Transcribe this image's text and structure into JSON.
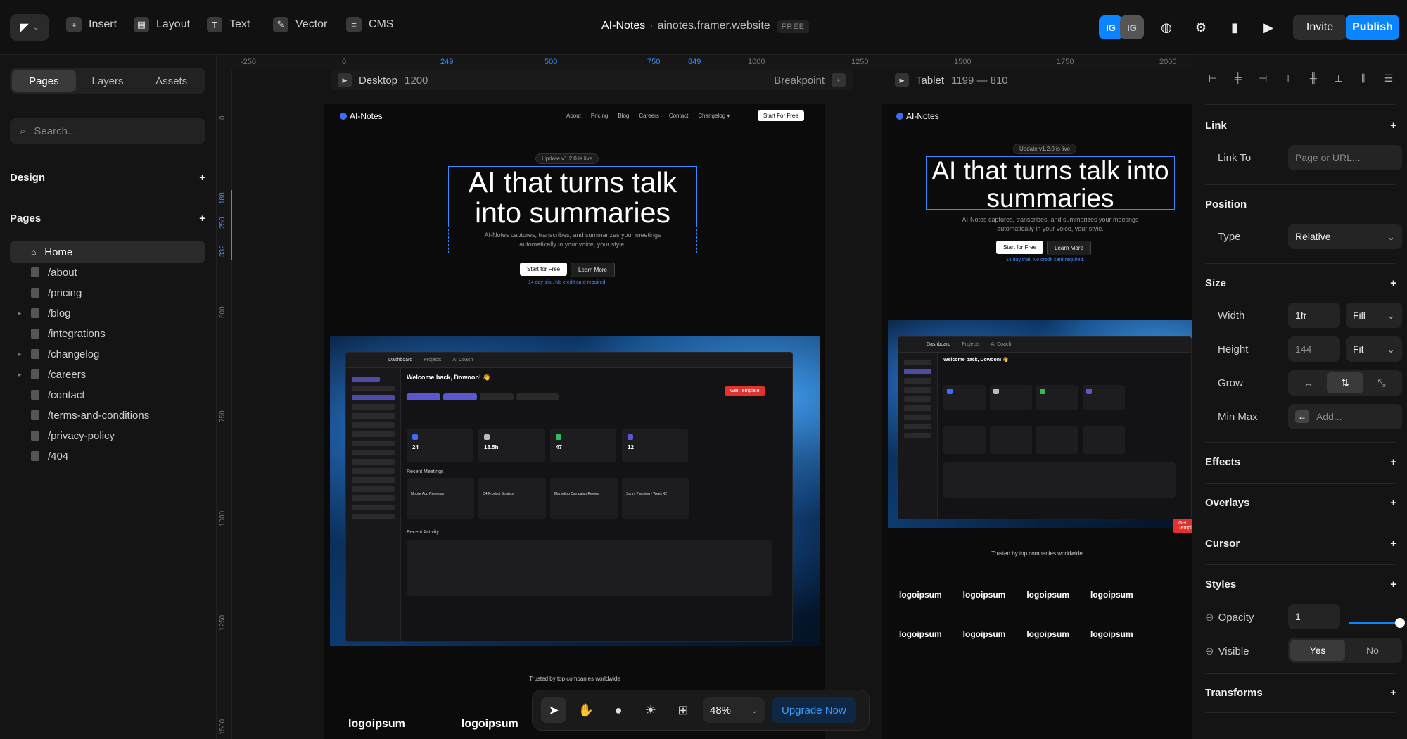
{
  "toolbar": {
    "tools": [
      {
        "label": "Insert",
        "icon": "plus-square-icon"
      },
      {
        "label": "Layout",
        "icon": "grid-icon"
      },
      {
        "label": "Text",
        "icon": "text-t-icon"
      },
      {
        "label": "Vector",
        "icon": "pen-icon"
      },
      {
        "label": "CMS",
        "icon": "database-icon"
      }
    ],
    "title": "AI-Notes",
    "title_sep": "·",
    "url": "ainotes.framer.website",
    "plan_badge": "FREE",
    "avatars": [
      "IG",
      "IG"
    ],
    "invite_label": "Invite",
    "publish_label": "Publish",
    "accent": "#0a84ff"
  },
  "left": {
    "tabs": [
      "Pages",
      "Layers",
      "Assets"
    ],
    "search_placeholder": "Search...",
    "design_heading": "Design",
    "pages_heading": "Pages",
    "pages": [
      {
        "name": "Home",
        "active": true,
        "caret": false
      },
      {
        "name": "/about",
        "caret": false
      },
      {
        "name": "/pricing",
        "caret": false
      },
      {
        "name": "/blog",
        "caret": true
      },
      {
        "name": "/integrations",
        "caret": false
      },
      {
        "name": "/changelog",
        "caret": true
      },
      {
        "name": "/careers",
        "caret": true
      },
      {
        "name": "/contact",
        "caret": false
      },
      {
        "name": "/terms-and-conditions",
        "caret": false
      },
      {
        "name": "/privacy-policy",
        "caret": false
      },
      {
        "name": "/404",
        "caret": false
      }
    ]
  },
  "canvas": {
    "ruler_h": [
      "-250",
      "0",
      "249",
      "500",
      "750",
      "849",
      "1000",
      "1250",
      "1500",
      "1750",
      "2000"
    ],
    "ruler_v": [
      "0",
      "188",
      "250",
      "332",
      "500",
      "750",
      "1000",
      "1250",
      "1500"
    ],
    "desktop": {
      "label": "Desktop",
      "size": "1200",
      "breakpoint": "Breakpoint"
    },
    "tablet": {
      "label": "Tablet",
      "size": "1199 — 810"
    },
    "site": {
      "brand": "AI-Notes",
      "nav": [
        "About",
        "Pricing",
        "Blog",
        "Careers",
        "Contact",
        "Changelog ▾"
      ],
      "nav_cta": "Start For Free",
      "update_pill": "Update v1.2.0 is live",
      "hero": "AI that turns talk into summaries",
      "hero_sub": "AI-Notes captures, transcribes, and summarizes your meetings automatically in your voice, your style.",
      "cta_primary": "Start for Free",
      "cta_secondary": "Learn More",
      "trial_note": "14 day trial. No credit card required.",
      "dash_tabs": [
        "Dashboard",
        "Projects",
        "AI Coach"
      ],
      "welcome": "Welcome back, Dowoon! 👋",
      "get_template": "Get Template",
      "stats": [
        "24",
        "18.5h",
        "47",
        "12"
      ],
      "recent_meetings": "Recent Meetings",
      "meetings": [
        "Mobile App Redesign",
        "Q4 Product Strategy",
        "Marketing Campaign Review",
        "Sprint Planning - Week 42"
      ],
      "recent_activity": "Recent Activity",
      "trusted": "Trusted by top companies worldwide",
      "logo_word": "logoipsum"
    }
  },
  "bottom_bar": {
    "zoom": "48%",
    "upgrade_label": "Upgrade Now"
  },
  "right": {
    "link_heading": "Link",
    "link_to_label": "Link To",
    "link_to_placeholder": "Page or URL...",
    "position_heading": "Position",
    "type_label": "Type",
    "type_value": "Relative",
    "size_heading": "Size",
    "width_label": "Width",
    "width_value": "1fr",
    "width_mode": "Fill",
    "height_label": "Height",
    "height_value": "144",
    "height_mode": "Fit",
    "grow_label": "Grow",
    "minmax_label": "Min Max",
    "minmax_placeholder": "Add...",
    "effects_heading": "Effects",
    "overlays_heading": "Overlays",
    "cursor_heading": "Cursor",
    "styles_heading": "Styles",
    "opacity_label": "Opacity",
    "opacity_value": "1",
    "visible_label": "Visible",
    "visible_yes": "Yes",
    "visible_no": "No",
    "transforms_heading": "Transforms"
  }
}
